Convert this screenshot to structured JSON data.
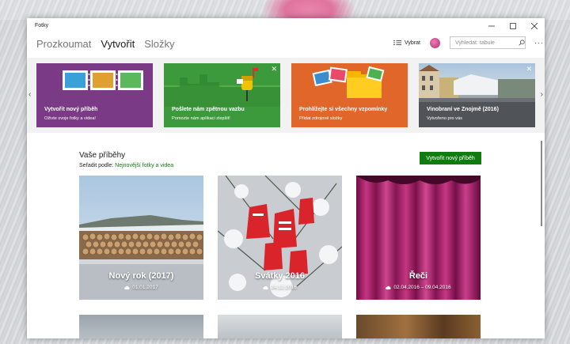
{
  "window": {
    "title": "Fotky"
  },
  "nav": {
    "tabs": [
      {
        "label": "Prozkoumat",
        "active": false
      },
      {
        "label": "Vytvořit",
        "active": true
      },
      {
        "label": "Složky",
        "active": false
      }
    ],
    "select_label": "Vybrat",
    "search_placeholder": "Vyhledat: tabule"
  },
  "banner": {
    "cards": [
      {
        "title": "Vytvořit nový příběh",
        "subtitle": "Oživte svoje fotky a videa!",
        "color": "#7a3a86"
      },
      {
        "title": "Pošlete nám zpětnou vazbu",
        "subtitle": "Pomozte nám aplikaci zlepšit!",
        "color": "#3c9a3c"
      },
      {
        "title": "Prohlížejte si všechny vzpomínky",
        "subtitle": "Přidat zdrojové složky",
        "color": "#e0662a"
      },
      {
        "title": "Vinobraní ve Znojmě (2016)",
        "subtitle": "Vytvořeno pro vás",
        "color": "#556070"
      }
    ]
  },
  "stories": {
    "heading": "Vaše příběhy",
    "sort_prefix": "Seřadit podle:",
    "sort_value": "Nejnovější fotky a videa",
    "create_button": "Vytvořit nový příběh",
    "items": [
      {
        "name": "Nový rok (2017)",
        "date": "01.01.2017"
      },
      {
        "name": "Svátky 2016",
        "date": "24.12.2016"
      },
      {
        "name": "Řeči",
        "date": "02.04.2016 – 09.04.2016"
      }
    ]
  },
  "colors": {
    "accent": "#107c10"
  }
}
